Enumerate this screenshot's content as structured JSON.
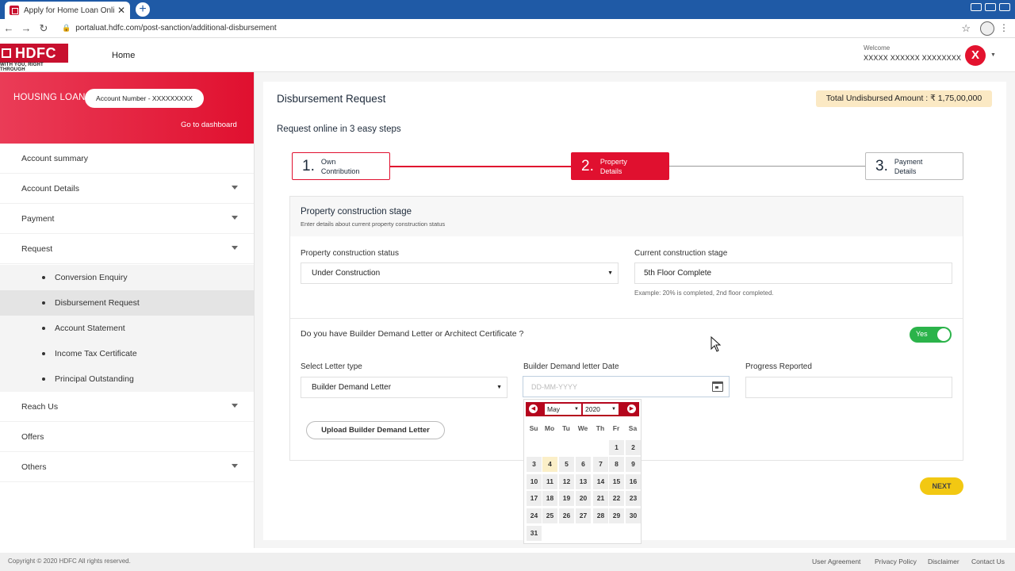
{
  "browser": {
    "tab_title": "Apply for Home Loan Online | ...",
    "tab_close": "✕",
    "new_tab": "+",
    "url": "portaluat.hdfc.com/post-sanction/additional-disbursement"
  },
  "header": {
    "logo_text": "HDFC",
    "logo_tagline": "WITH YOU, RIGHT THROUGH",
    "home_label": "Home",
    "welcome_label": "Welcome",
    "user_name": "XXXXX XXXXXX XXXXXXXX",
    "avatar_letter": "X"
  },
  "sidebar": {
    "loan_type": "HOUSING LOAN",
    "account_number": "Account Number - XXXXXXXXX",
    "goto_dashboard": "Go to dashboard",
    "items": [
      {
        "label": "Account summary"
      },
      {
        "label": "Account Details"
      },
      {
        "label": "Payment"
      },
      {
        "label": "Request"
      },
      {
        "label": "Reach Us"
      },
      {
        "label": "Offers"
      },
      {
        "label": "Others"
      }
    ],
    "sub_items": [
      {
        "label": "Conversion Enquiry"
      },
      {
        "label": "Disbursement Request"
      },
      {
        "label": "Account Statement"
      },
      {
        "label": "Income Tax Certificate"
      },
      {
        "label": "Principal Outstanding"
      }
    ]
  },
  "main": {
    "title": "Disbursement Request",
    "undisbursed": "Total Undisbursed Amount : ₹ 1,75,00,000",
    "steps_intro": "Request online in 3 easy steps",
    "steps": [
      {
        "num": "1.",
        "line1": "Own",
        "line2": "Contribution"
      },
      {
        "num": "2.",
        "line1": "Property",
        "line2": "Details"
      },
      {
        "num": "3.",
        "line1": "Payment",
        "line2": "Details"
      }
    ],
    "section_title": "Property construction stage",
    "section_sub": "Enter details about current property construction status",
    "status_label": "Property construction status",
    "status_value": "Under Construction",
    "stage_label": "Current construction stage",
    "stage_value": "5th Floor Complete",
    "stage_hint": "Example: 20% is completed, 2nd floor completed.",
    "question": "Do you have Builder Demand Letter or Architect Certificate ?",
    "toggle_label": "Yes",
    "letter_type_label": "Select Letter type",
    "letter_type_value": "Builder Demand Letter",
    "date_label": "Builder Demand letter Date",
    "date_placeholder": "DD-MM-YYYY",
    "progress_label": "Progress Reported",
    "upload_button": "Upload Builder Demand Letter",
    "next_button": "NEXT"
  },
  "datepicker": {
    "month": "May",
    "year": "2020",
    "prev": "◀",
    "next": "▶",
    "weekdays": [
      "Su",
      "Mo",
      "Tu",
      "We",
      "Th",
      "Fr",
      "Sa"
    ],
    "days": [
      "1",
      "2",
      "3",
      "4",
      "5",
      "6",
      "7",
      "8",
      "9",
      "10",
      "11",
      "12",
      "13",
      "14",
      "15",
      "16",
      "17",
      "18",
      "19",
      "20",
      "21",
      "22",
      "23",
      "24",
      "25",
      "26",
      "27",
      "28",
      "29",
      "30",
      "31"
    ],
    "today": "4"
  },
  "footer": {
    "copyright": "Copyright © 2020 HDFC All rights reserved.",
    "links": [
      "User Agreement",
      "Privacy Policy",
      "Disclaimer",
      "Contact Us"
    ]
  },
  "colors": {
    "brand_red": "#e0102f",
    "toggle_green": "#2bb34a",
    "next_yellow": "#f2c812"
  }
}
